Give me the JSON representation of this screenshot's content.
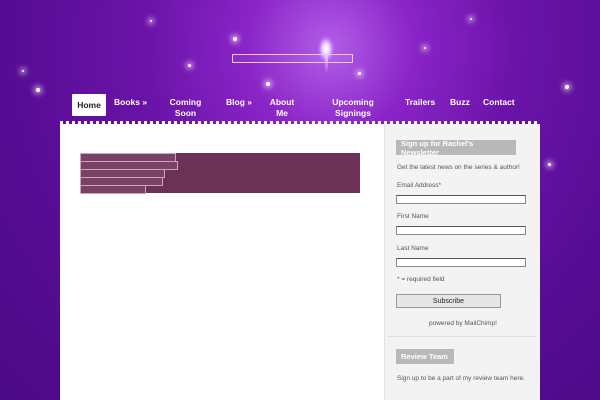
{
  "header": {
    "logo_alt": ""
  },
  "nav": {
    "home": "Home",
    "books": "Books »",
    "coming_soon": "Coming Soon",
    "blog": "Blog »",
    "about_me": "About Me",
    "upcoming_signings": "Upcoming Signings",
    "trailers": "Trailers",
    "buzz": "Buzz",
    "contact": "Contact"
  },
  "newsletter": {
    "title": "Sign up for Rachel's Newsletter",
    "tagline": "Get the latest news on the series & author!",
    "email_label": "Email Address*",
    "first_name_label": "First Name",
    "last_name_label": "Last Name",
    "required_note": "* = required field",
    "subscribe_label": "Subscribe",
    "powered_by": "powered by MailChimp!"
  },
  "review": {
    "title": "Review Team",
    "text": "Sign up to be a part of my review team here."
  },
  "colors": {
    "background": "#560c93",
    "content_bg": "#ffffff",
    "accent_block": "#6b3255"
  }
}
